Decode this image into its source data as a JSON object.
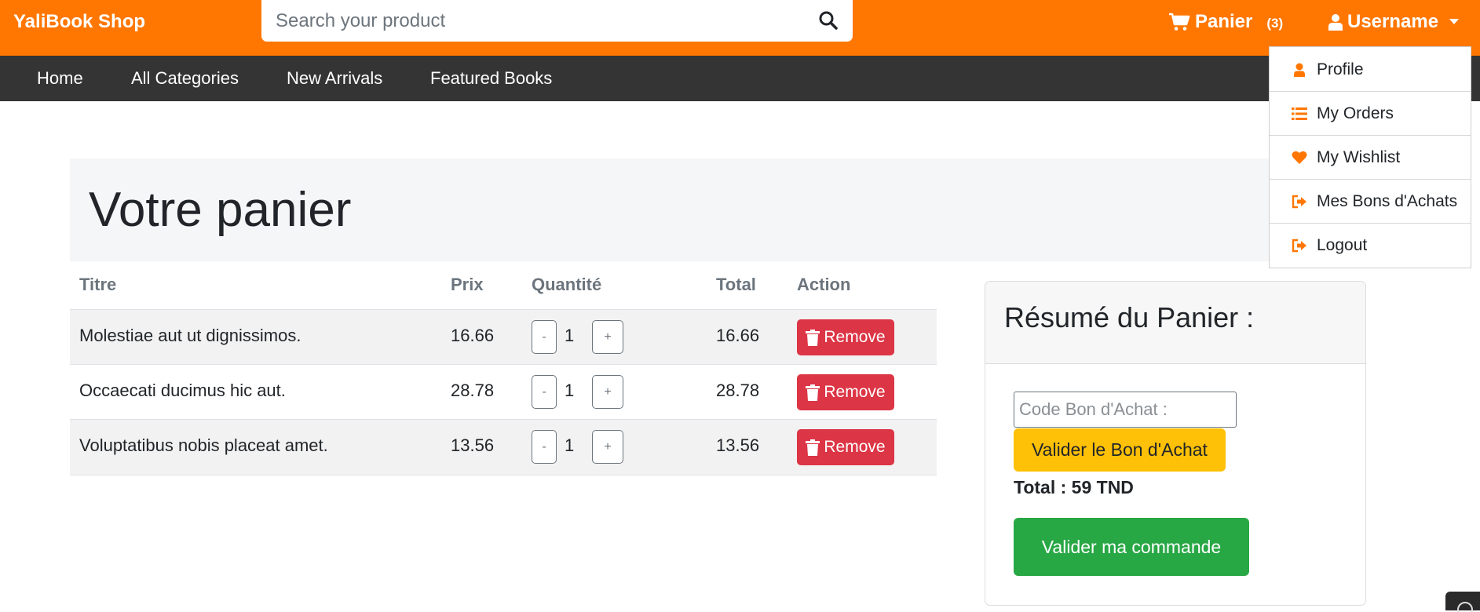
{
  "header": {
    "brand": "YaliBook Shop",
    "search_placeholder": "Search your product",
    "cart_label": "Panier",
    "cart_count": "(3)",
    "user_label": "Username"
  },
  "nav": {
    "items": [
      {
        "label": "Home"
      },
      {
        "label": "All Categories"
      },
      {
        "label": "New Arrivals"
      },
      {
        "label": "Featured Books"
      }
    ]
  },
  "user_menu": {
    "items": [
      {
        "label": "Profile",
        "icon": "user-icon"
      },
      {
        "label": "My Orders",
        "icon": "list-icon"
      },
      {
        "label": "My Wishlist",
        "icon": "heart-icon"
      },
      {
        "label": "Mes Bons d'Achats",
        "icon": "sign-out-icon"
      },
      {
        "label": "Logout",
        "icon": "sign-out-icon"
      }
    ]
  },
  "page": {
    "title": "Votre panier"
  },
  "cart_table": {
    "headers": {
      "title": "Titre",
      "price": "Prix",
      "quantity": "Quantité",
      "total": "Total",
      "action": "Action"
    },
    "rows": [
      {
        "title": "Molestiae aut ut dignissimos.",
        "price": "16.66",
        "qty": "1",
        "total": "16.66"
      },
      {
        "title": "Occaecati ducimus hic aut.",
        "price": "28.78",
        "qty": "1",
        "total": "28.78"
      },
      {
        "title": "Voluptatibus nobis placeat amet.",
        "price": "13.56",
        "qty": "1",
        "total": "13.56"
      }
    ],
    "minus_label": "-",
    "plus_label": "+",
    "remove_label": "Remove"
  },
  "summary": {
    "title": "Résumé du Panier :",
    "voucher_placeholder": "Code Bon d'Achat :",
    "validate_voucher_label": "Valider le Bon d'Achat",
    "total_text": "Total : 59 TND",
    "checkout_label": "Valider ma commande"
  },
  "colors": {
    "brand_orange": "#ff7700",
    "nav_dark": "#343434",
    "danger": "#dc3545",
    "warning": "#ffc107",
    "success": "#28a745"
  }
}
